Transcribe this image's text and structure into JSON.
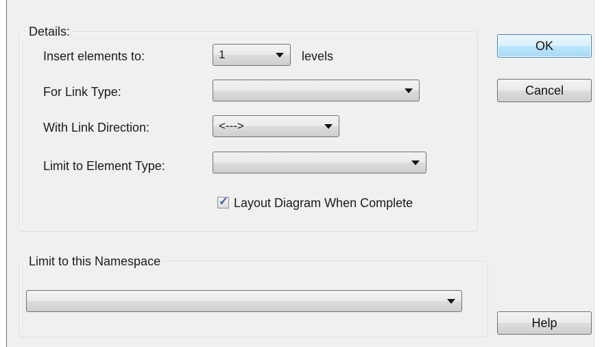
{
  "details": {
    "title": "Details:",
    "insert_label": "Insert elements to:",
    "insert_value": "1",
    "levels_label": "levels",
    "link_type_label": "For Link Type:",
    "link_type_value": "",
    "link_direction_label": "With Link Direction:",
    "link_direction_value": "<--->",
    "element_type_label": "Limit to Element Type:",
    "element_type_value": "",
    "layout_label": "Layout Diagram When Complete",
    "layout_checked": true
  },
  "namespace": {
    "title": "Limit to this Namespace",
    "value": ""
  },
  "buttons": {
    "ok": "OK",
    "cancel": "Cancel",
    "help": "Help"
  }
}
